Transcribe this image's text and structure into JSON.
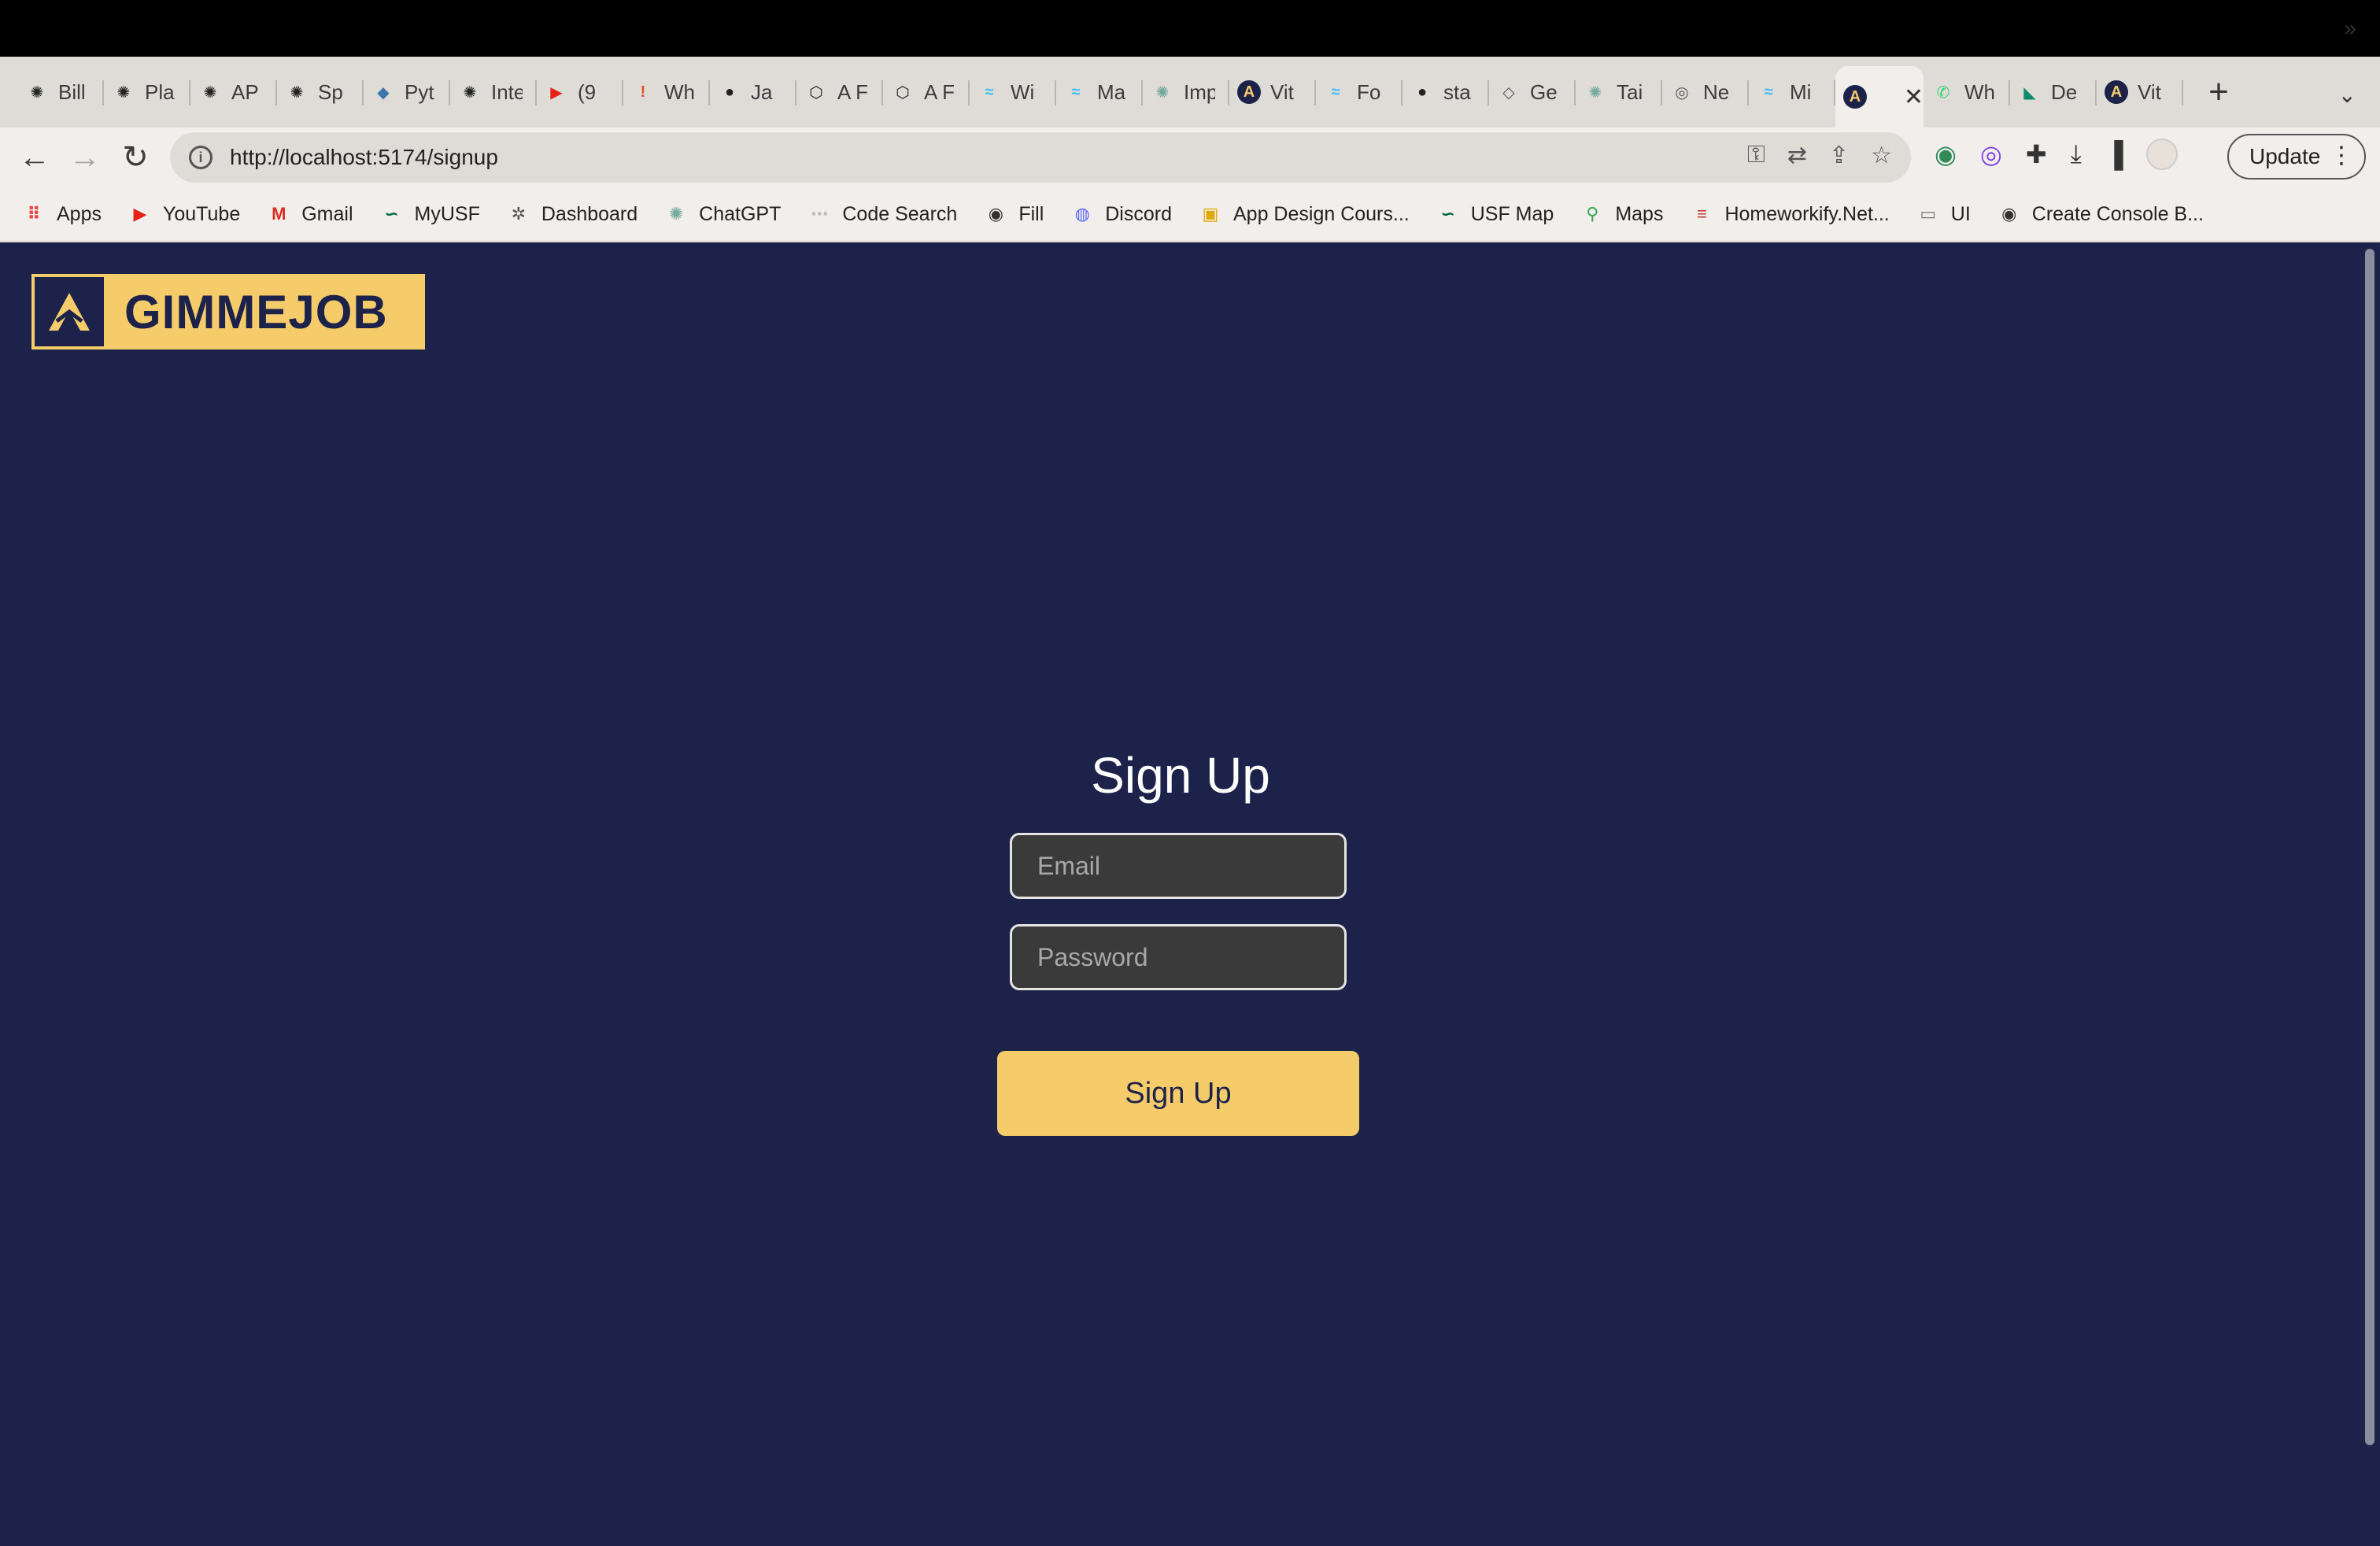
{
  "browser": {
    "tabs": [
      {
        "title": "Bill",
        "icon": "openai-icon",
        "color": "#222222"
      },
      {
        "title": "Pla",
        "icon": "openai-icon",
        "color": "#222222"
      },
      {
        "title": "AP",
        "icon": "openai-icon",
        "color": "#222222"
      },
      {
        "title": "Sp",
        "icon": "openai-icon",
        "color": "#222222"
      },
      {
        "title": "Pyt",
        "icon": "python-icon",
        "color": "#3b77a8"
      },
      {
        "title": "Inte",
        "icon": "openai-icon",
        "color": "#222222"
      },
      {
        "title": "(9",
        "icon": "youtube-icon",
        "color": "#e62117"
      },
      {
        "title": "Wh",
        "icon": "alert-icon",
        "color": "#e0502c"
      },
      {
        "title": "Ja",
        "icon": "github-icon",
        "color": "#222222"
      },
      {
        "title": "A F",
        "icon": "codepen-icon",
        "color": "#222222"
      },
      {
        "title": "A F",
        "icon": "codepen-icon",
        "color": "#222222"
      },
      {
        "title": "Wi",
        "icon": "tailwind-icon",
        "color": "#38bdf8"
      },
      {
        "title": "Ma",
        "icon": "tailwind-icon",
        "color": "#38bdf8"
      },
      {
        "title": "Imp",
        "icon": "chatgpt-icon",
        "color": "#74aa9c"
      },
      {
        "title": "Vit",
        "icon": "gimmejob-icon",
        "color": "#1c224a"
      },
      {
        "title": "Fo",
        "icon": "tailwind-icon",
        "color": "#38bdf8"
      },
      {
        "title": "sta",
        "icon": "github-icon",
        "color": "#222222"
      },
      {
        "title": "Ge",
        "icon": "sketch-icon",
        "color": "#555555"
      },
      {
        "title": "Tai",
        "icon": "chatgpt-icon",
        "color": "#74aa9c"
      },
      {
        "title": "Ne",
        "icon": "chrome-icon",
        "color": "#555555"
      },
      {
        "title": "Mi",
        "icon": "tailwind-icon",
        "color": "#38bdf8"
      },
      {
        "title": "",
        "icon": "gimmejob-icon",
        "color": "#1c224a",
        "active": true
      },
      {
        "title": "Wh",
        "icon": "whatsapp-icon",
        "color": "#25d366"
      },
      {
        "title": "De",
        "icon": "deepl-icon",
        "color": "#0f8a6a"
      },
      {
        "title": "Vit",
        "icon": "gimmejob-icon",
        "color": "#1c224a"
      }
    ],
    "address": {
      "url": "http://localhost:5174/signup"
    },
    "update_label": "Update",
    "bookmarks": [
      {
        "label": "Apps",
        "icon": "apps-grid-icon",
        "color": "#e44"
      },
      {
        "label": "YouTube",
        "icon": "youtube-icon",
        "color": "#e62117"
      },
      {
        "label": "Gmail",
        "icon": "gmail-icon",
        "color": "#d93025"
      },
      {
        "label": "MyUSF",
        "icon": "usf-icon",
        "color": "#006747"
      },
      {
        "label": "Dashboard",
        "icon": "dashboard-icon",
        "color": "#555555"
      },
      {
        "label": "ChatGPT",
        "icon": "chatgpt-icon",
        "color": "#74aa9c"
      },
      {
        "label": "Code Search",
        "icon": "code-search-icon",
        "color": "#bbbbbb"
      },
      {
        "label": "Fill",
        "icon": "globe-icon",
        "color": "#333333"
      },
      {
        "label": "Discord",
        "icon": "discord-icon",
        "color": "#5865f2"
      },
      {
        "label": "App Design Cours...",
        "icon": "course-icon",
        "color": "#e0a800"
      },
      {
        "label": "USF Map",
        "icon": "usf-icon",
        "color": "#006747"
      },
      {
        "label": "Maps",
        "icon": "maps-pin-icon",
        "color": "#34a853"
      },
      {
        "label": "Homeworkify.Net...",
        "icon": "books-icon",
        "color": "#c0392b"
      },
      {
        "label": "UI",
        "icon": "folder-icon",
        "color": "#777777"
      },
      {
        "label": "Create Console B...",
        "icon": "globe-icon",
        "color": "#333333"
      }
    ]
  },
  "page": {
    "logo_text": "GIMMEJOB",
    "title": "Sign Up",
    "email_placeholder": "Email",
    "password_placeholder": "Password",
    "submit_label": "Sign Up",
    "colors": {
      "background": "#1c224a",
      "accent": "#f6cc6b"
    }
  }
}
